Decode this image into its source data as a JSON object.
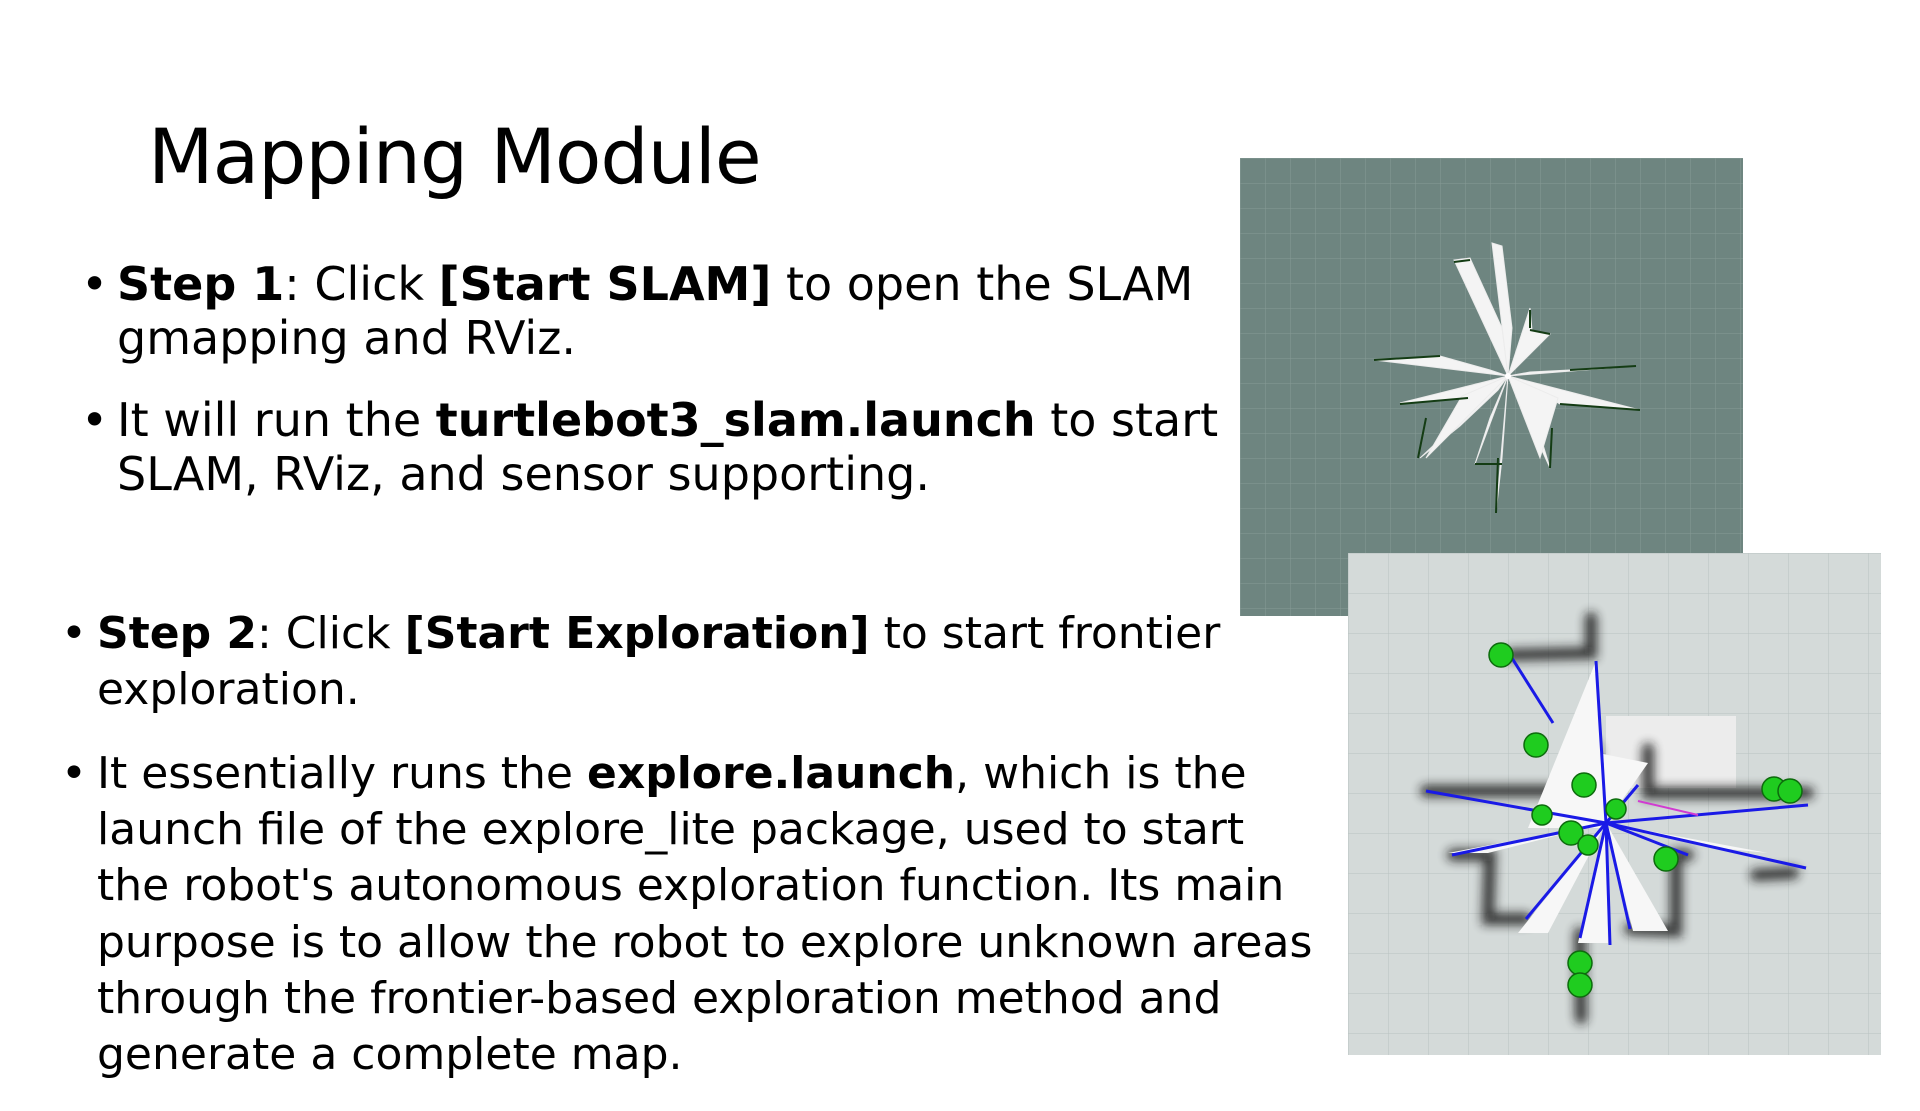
{
  "slide": {
    "title": "Mapping Module"
  },
  "group1": {
    "items": [
      {
        "lead": "Step 1",
        "sep": ": Click ",
        "button": "[Start SLAM]",
        "rest": " to open the SLAM gmapping and RViz."
      },
      {
        "pre": "It will run the ",
        "file": "turtlebot3_slam.launch",
        "rest": " to start SLAM, RViz, and sensor supporting."
      }
    ]
  },
  "group2": {
    "items": [
      {
        "lead": "Step 2",
        "sep": ": Click ",
        "button": "[Start Exploration]",
        "rest": " to start frontier exploration."
      },
      {
        "pre": "It essentially runs the ",
        "file": "explore.launch",
        "rest": ", which is the launch file of the explore_lite package, used to start the robot's autonomous exploration function. Its main purpose is to allow the robot to explore unknown areas through the frontier-based exploration method and generate a complete map."
      }
    ]
  },
  "colors": {
    "map1_background": "#6e8580",
    "map2_background": "#d4dad9",
    "frontier_marker": "#1fcc1f",
    "laser_ray": "#1a1ae6"
  }
}
